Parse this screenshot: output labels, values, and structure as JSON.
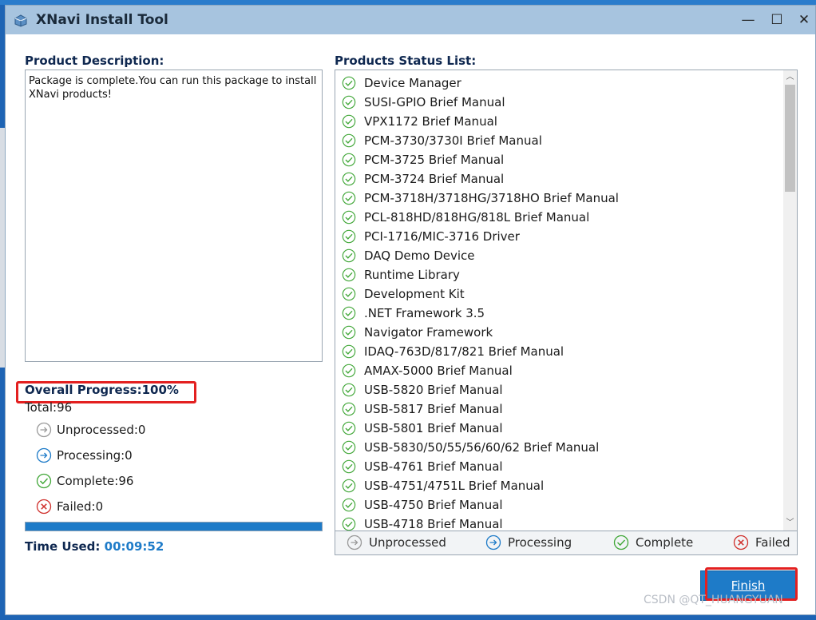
{
  "window": {
    "title": "XNavi Install Tool",
    "minimize": "—",
    "maximize": "☐",
    "close": "✕"
  },
  "description": {
    "label": "Product Description:",
    "text": "Package is complete.You can run this package to install XNavi products!"
  },
  "progress": {
    "label": "Overall Progress:100%",
    "percent": 100,
    "total": "Total:96",
    "unprocessed": "Unprocessed:0",
    "processing": "Processing:0",
    "complete": "Complete:96",
    "failed": "Failed:0",
    "time_label": "Time Used:",
    "time_value": "00:09:52"
  },
  "products": {
    "label": "Products Status List:",
    "items": [
      "Device Manager",
      "SUSI-GPIO Brief Manual",
      "VPX1172 Brief Manual",
      "PCM-3730/3730I Brief Manual",
      "PCM-3725 Brief Manual",
      "PCM-3724 Brief Manual",
      "PCM-3718H/3718HG/3718HO Brief Manual",
      "PCL-818HD/818HG/818L Brief Manual",
      "PCI-1716/MIC-3716 Driver",
      "DAQ Demo Device",
      "Runtime Library",
      "Development Kit",
      ".NET Framework 3.5",
      "Navigator Framework",
      "IDAQ-763D/817/821 Brief Manual",
      "AMAX-5000 Brief Manual",
      "USB-5820 Brief Manual",
      "USB-5817 Brief Manual",
      "USB-5801 Brief Manual",
      "USB-5830/50/55/56/60/62 Brief Manual",
      "USB-4761 Brief Manual",
      "USB-4751/4751L Brief Manual",
      "USB-4750 Brief Manual",
      "USB-4718 Brief Manual"
    ]
  },
  "legend": {
    "unprocessed": "Unprocessed",
    "processing": "Processing",
    "complete": "Complete",
    "failed": "Failed"
  },
  "buttons": {
    "finish": "Finish"
  },
  "watermark": "CSDN @QT_HUANGYUAN",
  "colors": {
    "titlebar": "#a7c4df",
    "accent": "#1e7bc8",
    "check": "#43a83a",
    "failed": "#d0312d",
    "highlight": "#e32020"
  }
}
